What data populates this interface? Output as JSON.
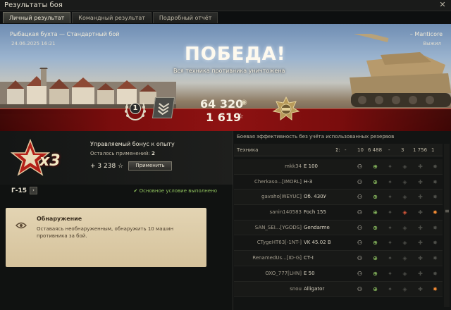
{
  "window": {
    "title": "Результаты боя"
  },
  "tabs": [
    {
      "label": "Личный результат",
      "active": true
    },
    {
      "label": "Командный результат",
      "active": false
    },
    {
      "label": "Подробный отчёт",
      "active": false
    }
  ],
  "battle": {
    "map": "Рыбацкая бухта — Стандартный бой",
    "date": "24.06.2025 16:21",
    "player": "– Manticore",
    "exit": "Выжил",
    "result": "ПОБЕДА!",
    "result_sub": "Вся техника противника уничтожена",
    "rank": "1",
    "credits": "64 320",
    "xp": "1 619"
  },
  "bonus": {
    "multiplier": "x3",
    "title": "Управляемый бонус к опыту",
    "remaining_label": "Осталось применений:",
    "remaining_value": "2",
    "amount": "+ 3 238",
    "apply_label": "Применить"
  },
  "mission": {
    "id": "Г-15",
    "arrow": "›",
    "status": "Основное условие выполнено",
    "task_title": "Обнаружение",
    "task_desc": "Оставаясь необнаруженным, обнаружить 10 машин противника за бой."
  },
  "efficiency": {
    "title": "Боевая эффективность без учёта использованных резервов",
    "columns": {
      "vehicle": "Техника",
      "sigma": "Σ:",
      "c0": "-",
      "c1": "10",
      "c2": "6 488",
      "c3": "-",
      "c4": "3",
      "c5": "1 756",
      "c6": "1"
    },
    "rows": [
      {
        "player": "mkk34",
        "vehicle": "E 100",
        "hit": false,
        "fire": false
      },
      {
        "player": "Cherkaso...[IMORL]",
        "vehicle": "Н-3",
        "hit": false,
        "fire": false
      },
      {
        "player": "gavaho[WEYUC]",
        "vehicle": "Об. 430У",
        "hit": false,
        "fire": false
      },
      {
        "player": "sanin140583",
        "vehicle": "Foch 155",
        "hit": true,
        "fire": true
      },
      {
        "player": "SAN_SEI...[YGODS]",
        "vehicle": "Gendarme",
        "hit": false,
        "fire": false
      },
      {
        "player": "CTygeHT63[-1NT-]",
        "vehicle": "VK 45.02 B",
        "hit": false,
        "fire": false
      },
      {
        "player": "RenamedUs...[ID-G]",
        "vehicle": "СТ-I",
        "hit": false,
        "fire": false
      },
      {
        "player": "OXO_777[LHN]",
        "vehicle": "E 50",
        "hit": false,
        "fire": false
      },
      {
        "player": "snou",
        "vehicle": "Alligator",
        "hit": false,
        "fire": true
      }
    ]
  },
  "colors": {
    "accent_red": "#8e1212",
    "status_green": "#8fc25d",
    "card_bg": "#dccaa6"
  }
}
